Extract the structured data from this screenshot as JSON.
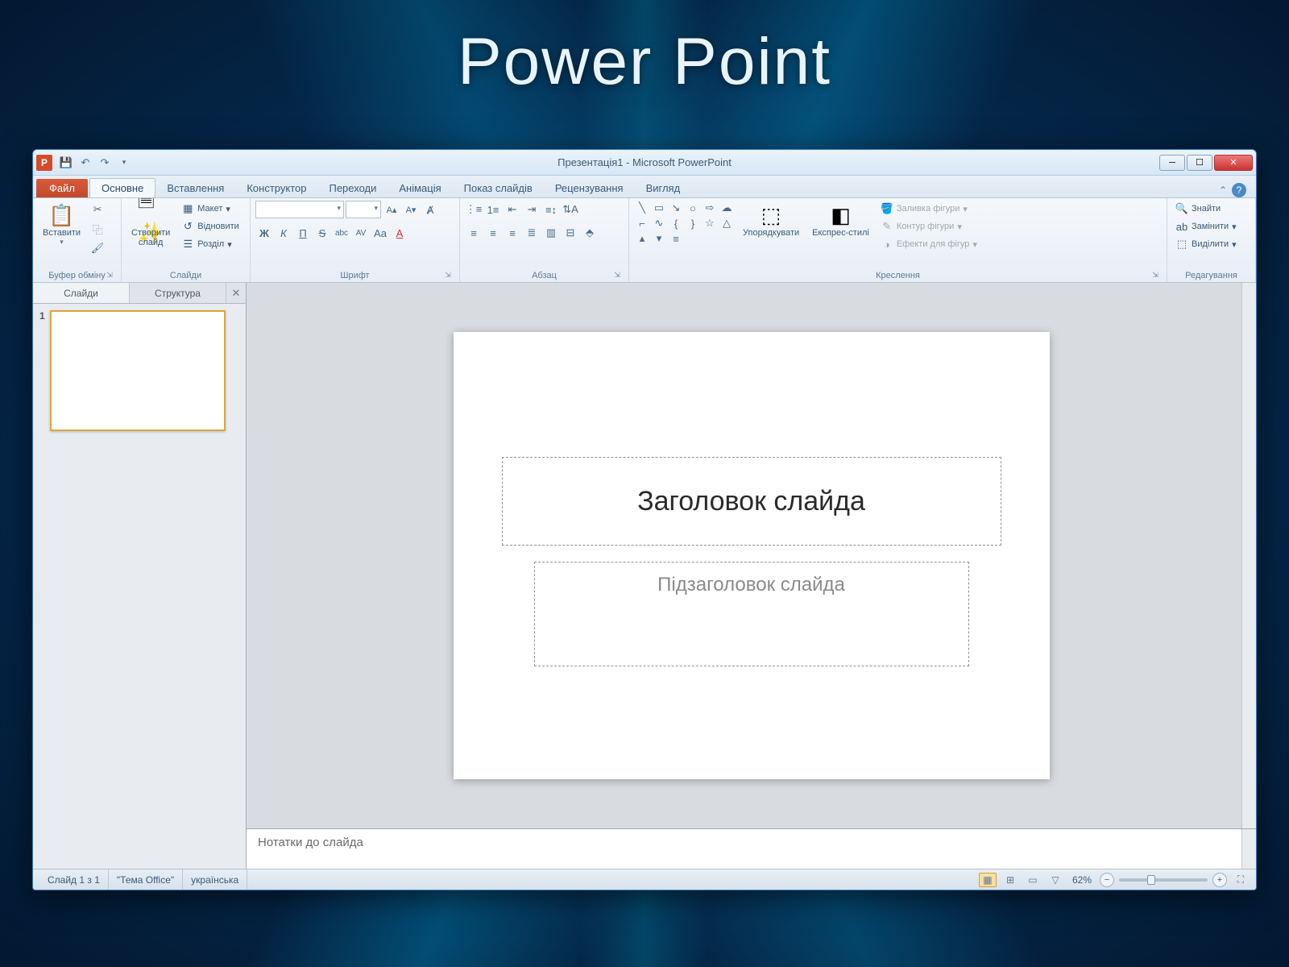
{
  "bgTitle": "Power  Point",
  "titlebar": {
    "docTitle": "Презентація1  -  Microsoft PowerPoint"
  },
  "tabs": {
    "file": "Файл",
    "items": [
      "Основне",
      "Вставлення",
      "Конструктор",
      "Переходи",
      "Анімація",
      "Показ слайдів",
      "Рецензування",
      "Вигляд"
    ]
  },
  "ribbon": {
    "clipboard": {
      "label": "Буфер обміну",
      "paste": "Вставити"
    },
    "slides": {
      "label": "Слайди",
      "new": "Створити\nслайд",
      "layout": "Макет",
      "reset": "Відновити",
      "section": "Розділ"
    },
    "font": {
      "label": "Шрифт"
    },
    "paragraph": {
      "label": "Абзац"
    },
    "drawing": {
      "label": "Креслення",
      "arrange": "Упорядкувати",
      "quick": "Експрес-стилі",
      "fill": "Заливка фігури",
      "outline": "Контур фігури",
      "effects": "Ефекти для фігур"
    },
    "editing": {
      "label": "Редагування",
      "find": "Знайти",
      "replace": "Замінити",
      "select": "Виділити"
    }
  },
  "pane": {
    "tabSlides": "Слайди",
    "tabOutline": "Структура",
    "slideNum": "1"
  },
  "slide": {
    "title": "Заголовок слайда",
    "subtitle": "Підзаголовок слайда"
  },
  "notes": {
    "placeholder": "Нотатки до слайда"
  },
  "status": {
    "slideOf": "Слайд 1 з 1",
    "theme": "\"Тема Office\"",
    "lang": "українська",
    "zoom": "62%"
  }
}
